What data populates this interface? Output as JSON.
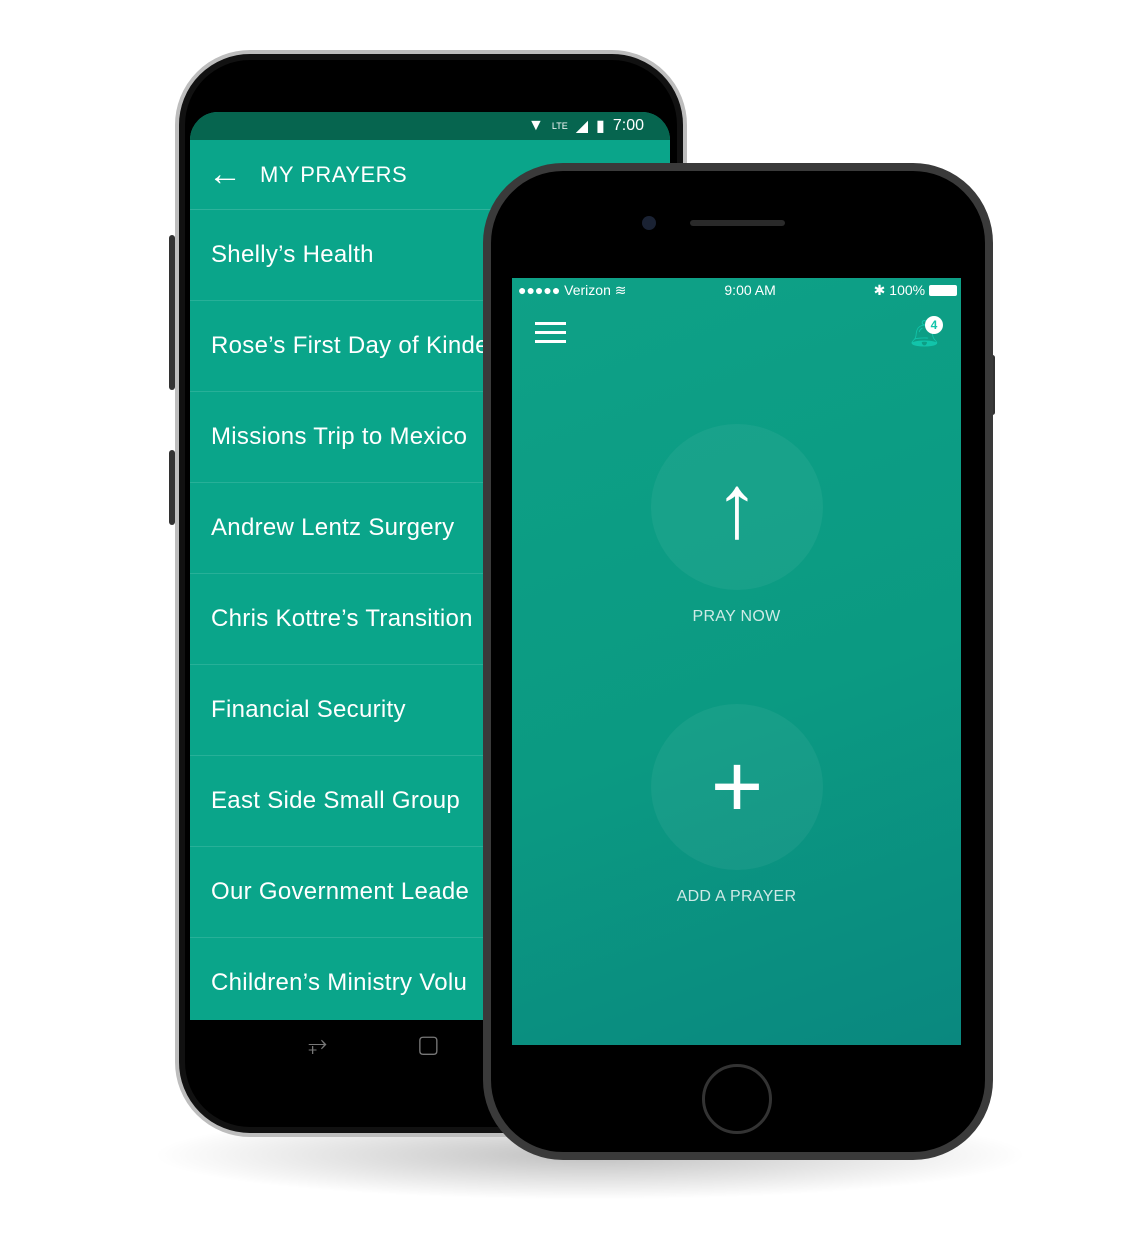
{
  "android": {
    "status": {
      "time": "7:00",
      "network": "LTE"
    },
    "title": "MY PRAYERS",
    "prayers": [
      "Shelly’s Health",
      "Rose’s First Day of Kinde",
      "Missions Trip to Mexico",
      "Andrew Lentz Surgery",
      "Chris Kottre’s Transition",
      "Financial Security",
      "East Side Small Group",
      "Our Government Leade",
      "Children’s Ministry Volu"
    ],
    "colors": {
      "status_bar": "#06654f",
      "app_bar": "#0aa58a"
    }
  },
  "iphone": {
    "status": {
      "carrier": "Verizon",
      "time": "9:00 AM",
      "battery": "100%"
    },
    "notification_count": "4",
    "pray_now": "PRAY NOW",
    "add_prayer": "ADD A PRAYER",
    "colors": {
      "accent": "#12c4aa",
      "background": "#0ea187"
    }
  }
}
